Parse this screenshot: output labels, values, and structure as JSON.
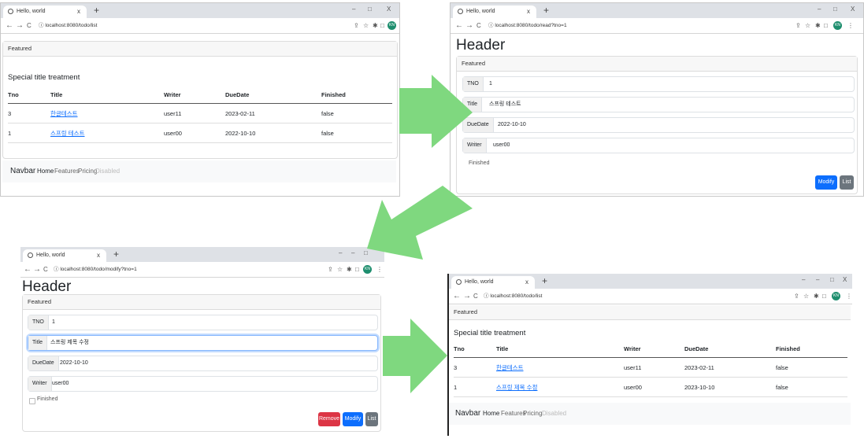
{
  "browser": {
    "tab_title": "Hello, world",
    "tab_close": "x",
    "new_tab": "+",
    "minimize": "–",
    "maximize": "□",
    "close": "X",
    "avatar": "KN",
    "back": "←",
    "forward": "→",
    "reload": "C",
    "info": "ⓘ"
  },
  "list_page": {
    "url": "localhost:8080/todo/list",
    "featured": "Featured",
    "card_title": "Special title treatment",
    "columns": [
      "Tno",
      "Title",
      "Writer",
      "DueDate",
      "Finished"
    ],
    "rows_before": [
      {
        "tno": "3",
        "title": "한글테스트",
        "writer": "user11",
        "duedate": "2023-02-11",
        "finished": "false"
      },
      {
        "tno": "1",
        "title": "스프링 테스트",
        "writer": "user00",
        "duedate": "2022-10-10",
        "finished": "false"
      }
    ],
    "rows_after": [
      {
        "tno": "3",
        "title": "한글테스트",
        "writer": "user11",
        "duedate": "2023-02-11",
        "finished": "false"
      },
      {
        "tno": "1",
        "title": "스프링 제목 수정",
        "writer": "user00",
        "duedate": "2023-10-10",
        "finished": "false"
      }
    ],
    "navbar": {
      "brand": "Navbar",
      "home": "Home",
      "features": "Features",
      "pricing": "Pricing",
      "disabled": "Disabled"
    }
  },
  "read_page": {
    "url": "localhost:8080/todo/read?tno=1",
    "header": "Header",
    "featured": "Featured",
    "tno_label": "TNO",
    "tno_value": "1",
    "title_label": "Title",
    "title_value": "스프링 테스트",
    "duedate_label": "DueDate",
    "duedate_value": "2022-10-10",
    "writer_label": "Writer",
    "writer_value": "user00",
    "finished_label": "Finished",
    "modify_btn": "Modify",
    "list_btn": "List"
  },
  "modify_page": {
    "url": "localhost:8080/todo/modify?tno=1",
    "header": "Header",
    "featured": "Featured",
    "tno_label": "TNO",
    "tno_value": "1",
    "title_label": "Title",
    "title_value": "스프링 제목 수정",
    "duedate_label": "DueDate",
    "duedate_value": "2022-10-10",
    "writer_label": "Writer",
    "writer_value": "user00",
    "finished_label": "Finished",
    "remove_btn": "Remove",
    "modify_btn": "Modify",
    "list_btn": "List"
  },
  "colors": {
    "arrow": "#7fd87f",
    "primary": "#0d6efd",
    "danger": "#dc3545",
    "secondary": "#6c757d"
  },
  "icons": [
    "globe-icon",
    "back-arrow-icon",
    "forward-arrow-icon",
    "reload-icon",
    "info-icon",
    "share-icon",
    "star-icon",
    "extensions-icon",
    "sidepanel-icon",
    "menu-icon"
  ]
}
